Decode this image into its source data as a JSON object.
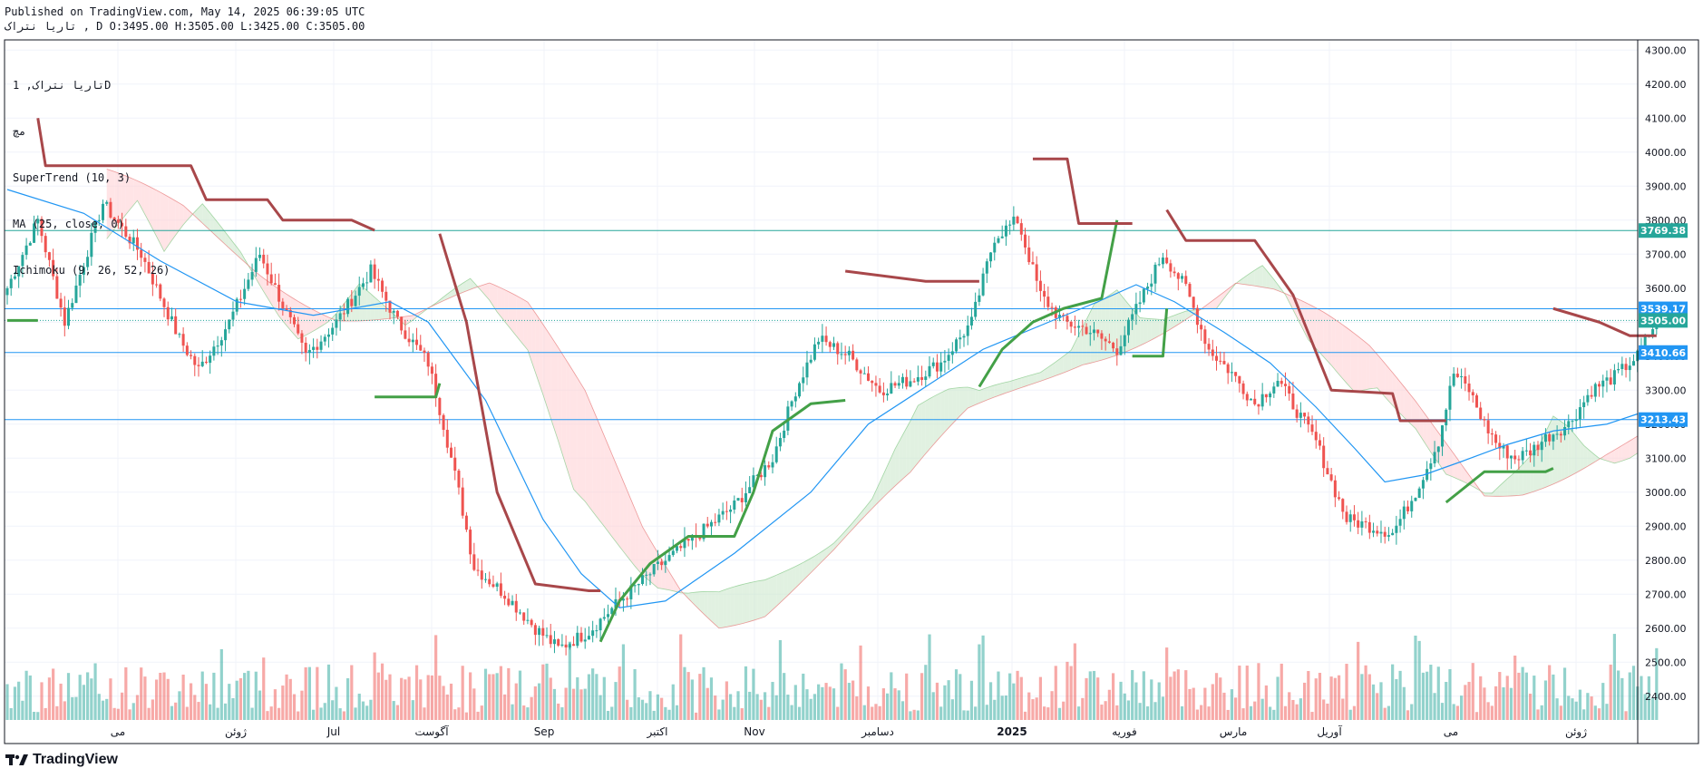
{
  "header": {
    "published": "Published on TradingView.com, May 14, 2025 06:39:05 UTC",
    "ohlc": "تاریا نتراک , D O:3495.00 H:3505.00 L:3425.00 C:3505.00"
  },
  "legend": {
    "symbol": "تاریا نتراک, 1D",
    "exchange": "مچ",
    "indicator_1": "SuperTrend (10, 3)",
    "indicator_2": "MA (25, close, 0)",
    "indicator_3": "Ichimoku (9, 26, 52, 26)"
  },
  "brand": {
    "name": "TradingView",
    "icon": "tradingview-logo-icon"
  },
  "colors": {
    "up": "#26a69a",
    "down": "#ef5350",
    "supertrend_up": "#43a047",
    "supertrend_down": "#a8474a",
    "ma": "#2196f3",
    "cloud_bull": "#c8e6c9",
    "cloud_bear": "#ffcdd2",
    "hline": "#26a69a",
    "hline_blue": "#2196f3"
  },
  "chart_data": {
    "type": "candlestick",
    "title": "",
    "xlabel": "",
    "ylabel": "",
    "ylim": [
      2330,
      4330
    ],
    "y_ticks": [
      "4300.00",
      "4200.00",
      "4100.00",
      "4000.00",
      "3900.00",
      "3800.00",
      "3700.00",
      "3600.00",
      "3500.00",
      "3400.00",
      "3300.00",
      "3200.00",
      "3100.00",
      "3000.00",
      "2900.00",
      "2800.00",
      "2700.00",
      "2600.00",
      "2500.00",
      "2400.00"
    ],
    "x_ticks": [
      "می",
      "ژوئن",
      "Jul",
      "آگوست",
      "Sep",
      "اکتبر",
      "Nov",
      "دسامبر",
      "2025",
      "فوریه",
      "مارس",
      "آوریل",
      "می",
      "ژوئن"
    ],
    "grid": true,
    "horizontal_levels": [
      {
        "value": 3769.38,
        "label": "3769.38"
      },
      {
        "value": 3539.17,
        "label": "3539.17"
      },
      {
        "value": 3410.66,
        "label": "3410.66"
      },
      {
        "value": 3213.43,
        "label": "3213.43"
      }
    ],
    "last_price": {
      "value": 3505.0,
      "label": "3505.00"
    },
    "price_keypoints": [
      [
        0,
        3600
      ],
      [
        8,
        3800
      ],
      [
        15,
        3500
      ],
      [
        25,
        3850
      ],
      [
        35,
        3700
      ],
      [
        45,
        3450
      ],
      [
        50,
        3360
      ],
      [
        58,
        3500
      ],
      [
        66,
        3700
      ],
      [
        72,
        3550
      ],
      [
        78,
        3400
      ],
      [
        86,
        3500
      ],
      [
        95,
        3650
      ],
      [
        102,
        3500
      ],
      [
        110,
        3380
      ],
      [
        114,
        3200
      ],
      [
        118,
        3000
      ],
      [
        122,
        2780
      ],
      [
        130,
        2700
      ],
      [
        138,
        2600
      ],
      [
        144,
        2540
      ],
      [
        152,
        2590
      ],
      [
        160,
        2680
      ],
      [
        170,
        2780
      ],
      [
        180,
        2870
      ],
      [
        190,
        2960
      ],
      [
        200,
        3100
      ],
      [
        206,
        3300
      ],
      [
        212,
        3450
      ],
      [
        220,
        3400
      ],
      [
        228,
        3300
      ],
      [
        236,
        3330
      ],
      [
        244,
        3380
      ],
      [
        252,
        3500
      ],
      [
        258,
        3750
      ],
      [
        264,
        3800
      ],
      [
        270,
        3580
      ],
      [
        276,
        3500
      ],
      [
        282,
        3480
      ],
      [
        290,
        3420
      ],
      [
        296,
        3560
      ],
      [
        302,
        3700
      ],
      [
        308,
        3600
      ],
      [
        314,
        3420
      ],
      [
        320,
        3350
      ],
      [
        326,
        3260
      ],
      [
        332,
        3330
      ],
      [
        338,
        3220
      ],
      [
        342,
        3150
      ],
      [
        346,
        3030
      ],
      [
        350,
        2920
      ],
      [
        356,
        2900
      ],
      [
        362,
        2880
      ],
      [
        368,
        3000
      ],
      [
        374,
        3150
      ],
      [
        378,
        3350
      ],
      [
        382,
        3300
      ],
      [
        386,
        3200
      ],
      [
        390,
        3130
      ],
      [
        394,
        3100
      ],
      [
        398,
        3120
      ],
      [
        402,
        3160
      ],
      [
        408,
        3200
      ],
      [
        414,
        3300
      ],
      [
        420,
        3340
      ],
      [
        426,
        3400
      ],
      [
        431,
        3505
      ]
    ],
    "ma_keypoints": [
      [
        0,
        3890
      ],
      [
        20,
        3820
      ],
      [
        40,
        3680
      ],
      [
        60,
        3560
      ],
      [
        80,
        3520
      ],
      [
        100,
        3560
      ],
      [
        110,
        3500
      ],
      [
        125,
        3270
      ],
      [
        140,
        2920
      ],
      [
        150,
        2760
      ],
      [
        160,
        2660
      ],
      [
        172,
        2680
      ],
      [
        190,
        2820
      ],
      [
        210,
        3000
      ],
      [
        225,
        3200
      ],
      [
        240,
        3310
      ],
      [
        255,
        3420
      ],
      [
        270,
        3490
      ],
      [
        285,
        3560
      ],
      [
        295,
        3610
      ],
      [
        305,
        3560
      ],
      [
        318,
        3470
      ],
      [
        330,
        3380
      ],
      [
        342,
        3250
      ],
      [
        352,
        3130
      ],
      [
        360,
        3030
      ],
      [
        370,
        3050
      ],
      [
        380,
        3090
      ],
      [
        392,
        3140
      ],
      [
        404,
        3180
      ],
      [
        418,
        3200
      ],
      [
        426,
        3230
      ]
    ],
    "supertrend": [
      {
        "trend": "up",
        "points": [
          [
            0,
            3505
          ],
          [
            7,
            3505
          ],
          [
            8,
            3505
          ]
        ]
      },
      {
        "trend": "down",
        "points": [
          [
            8,
            4100
          ],
          [
            10,
            3960
          ],
          [
            48,
            3960
          ],
          [
            52,
            3860
          ],
          [
            68,
            3860
          ],
          [
            72,
            3800
          ],
          [
            90,
            3800
          ],
          [
            96,
            3770
          ]
        ]
      },
      {
        "trend": "up",
        "points": [
          [
            96,
            3280
          ],
          [
            112,
            3280
          ],
          [
            113,
            3320
          ]
        ]
      },
      {
        "trend": "down",
        "points": [
          [
            113,
            3760
          ],
          [
            120,
            3500
          ],
          [
            128,
            3000
          ],
          [
            138,
            2730
          ],
          [
            152,
            2710
          ],
          [
            155,
            2710
          ]
        ]
      },
      {
        "trend": "up",
        "points": [
          [
            155,
            2560
          ],
          [
            160,
            2680
          ],
          [
            168,
            2790
          ],
          [
            178,
            2870
          ],
          [
            190,
            2870
          ],
          [
            195,
            3000
          ],
          [
            200,
            3180
          ],
          [
            210,
            3260
          ],
          [
            219,
            3270
          ]
        ]
      },
      {
        "trend": "down",
        "points": [
          [
            219,
            3650
          ],
          [
            240,
            3620
          ],
          [
            254,
            3620
          ]
        ]
      },
      {
        "trend": "up",
        "points": [
          [
            254,
            3310
          ],
          [
            260,
            3420
          ],
          [
            268,
            3500
          ],
          [
            276,
            3540
          ],
          [
            286,
            3570
          ],
          [
            290,
            3800
          ]
        ]
      },
      {
        "trend": "down",
        "points": [
          [
            268,
            3980
          ],
          [
            277,
            3980
          ],
          [
            280,
            3790
          ],
          [
            290,
            3790
          ],
          [
            294,
            3790
          ]
        ]
      },
      {
        "trend": "up",
        "points": [
          [
            294,
            3400
          ],
          [
            302,
            3400
          ],
          [
            303,
            3540
          ]
        ]
      },
      {
        "trend": "down",
        "points": [
          [
            303,
            3830
          ],
          [
            308,
            3740
          ],
          [
            326,
            3740
          ],
          [
            336,
            3580
          ],
          [
            346,
            3300
          ],
          [
            362,
            3290
          ],
          [
            364,
            3210
          ],
          [
            376,
            3210
          ]
        ]
      },
      {
        "trend": "up",
        "points": [
          [
            376,
            2970
          ],
          [
            386,
            3060
          ],
          [
            402,
            3060
          ],
          [
            404,
            3070
          ]
        ]
      },
      {
        "trend": "down",
        "points": [
          [
            404,
            3540
          ],
          [
            416,
            3500
          ],
          [
            424,
            3460
          ],
          [
            431,
            3460
          ]
        ]
      }
    ],
    "volume_max": 1000
  }
}
